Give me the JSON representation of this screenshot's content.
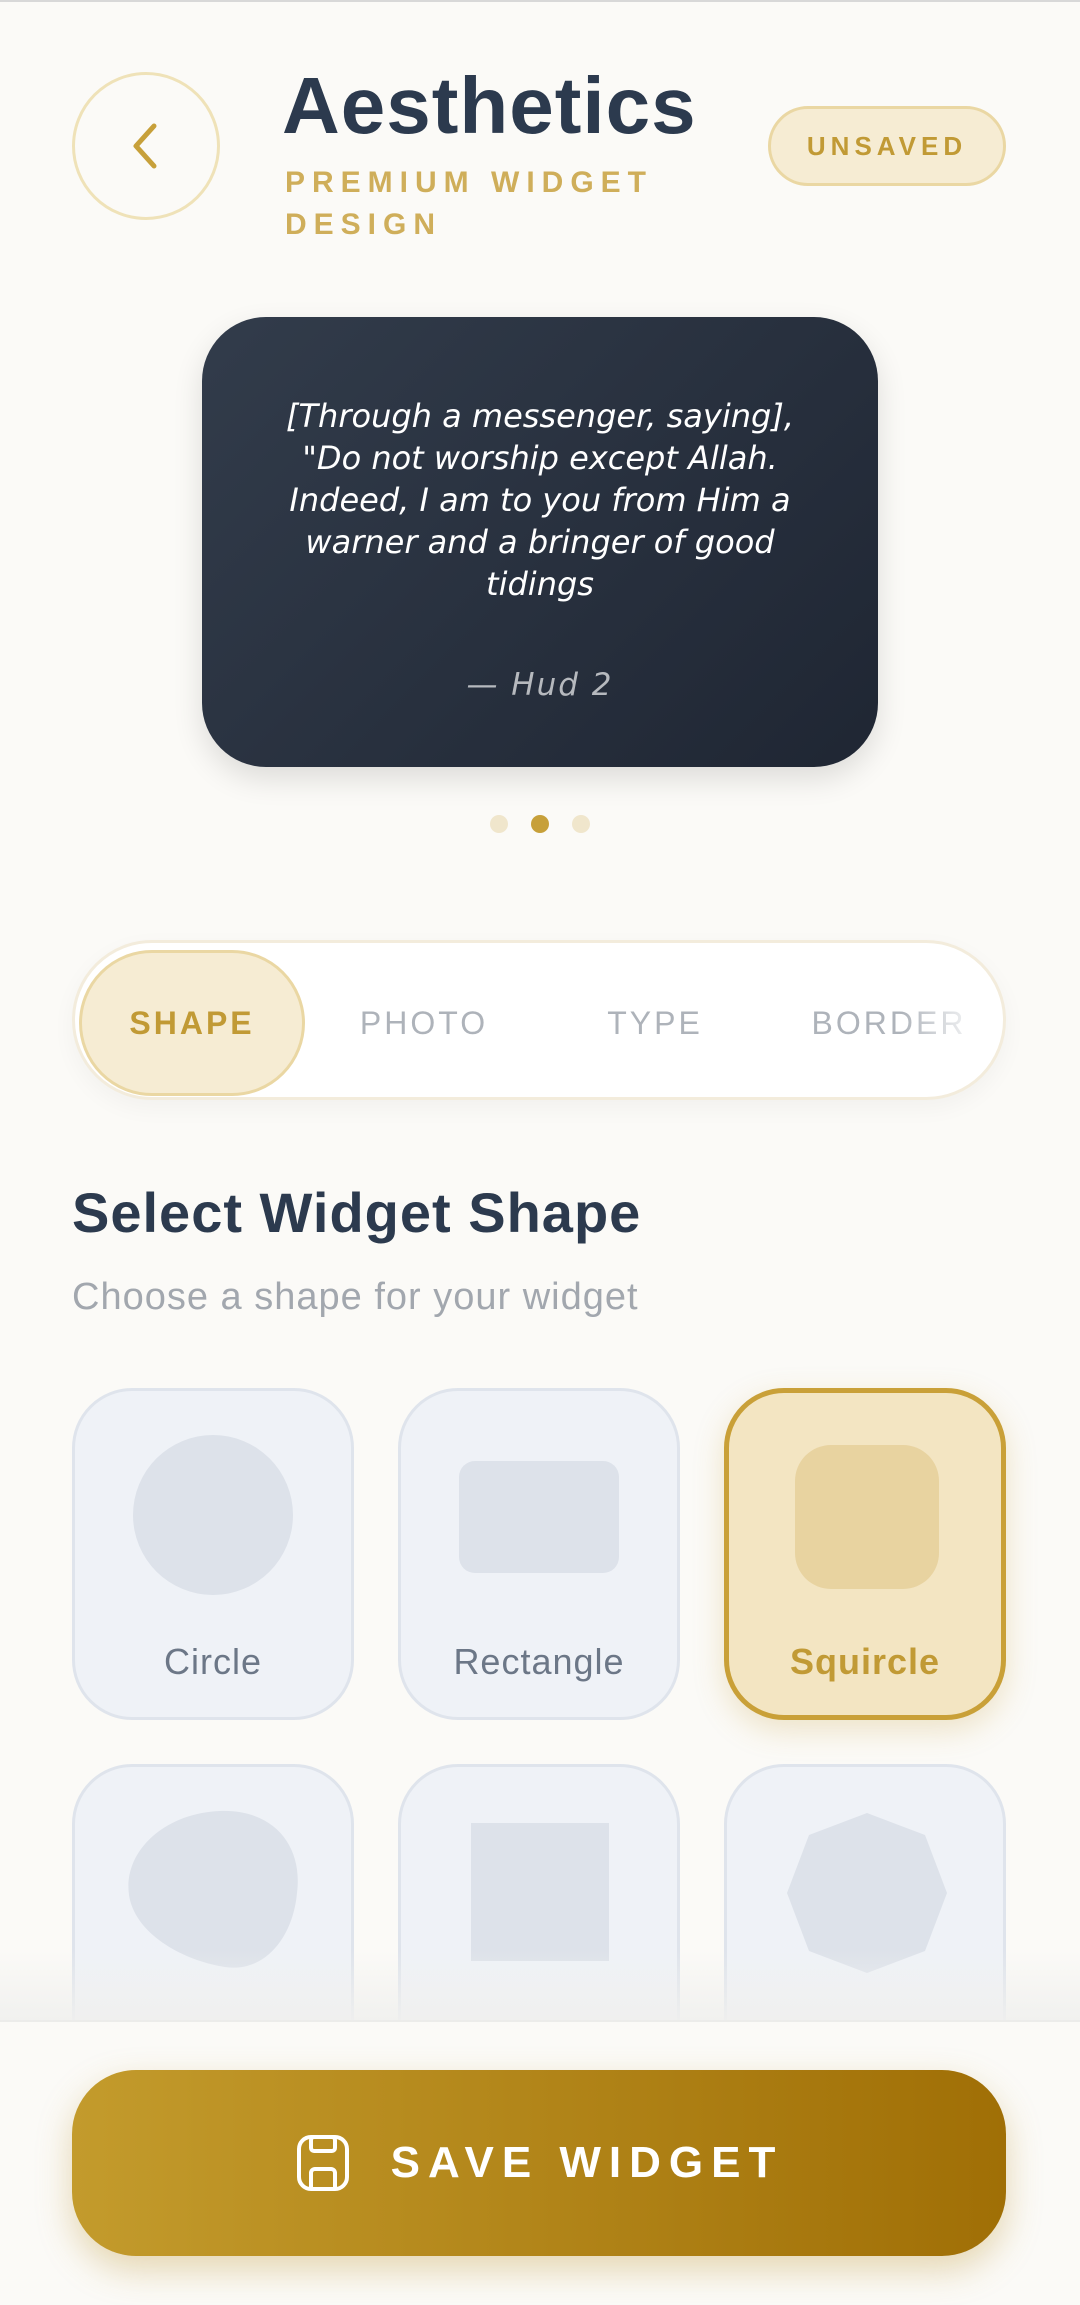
{
  "header": {
    "title": "Aesthetics",
    "subtitle": "PREMIUM WIDGET DESIGN",
    "status_badge": "UNSAVED"
  },
  "preview": {
    "quote": "[Through a messenger, saying], \"Do not worship except Allah. Indeed, I am to you from Him a warner and a bringer of good tidings",
    "reference": "— Hud 2",
    "pages": 3,
    "active_page": 2
  },
  "tabs": [
    {
      "label": "SHAPE",
      "active": true
    },
    {
      "label": "PHOTO",
      "active": false
    },
    {
      "label": "TYPE",
      "active": false
    },
    {
      "label": "BORDER",
      "active": false
    }
  ],
  "section": {
    "title": "Select Widget Shape",
    "subtitle": "Choose a shape for your widget"
  },
  "shapes": [
    {
      "label": "Circle",
      "selected": false
    },
    {
      "label": "Rectangle",
      "selected": false
    },
    {
      "label": "Squircle",
      "selected": true
    },
    {
      "label": "",
      "selected": false
    },
    {
      "label": "",
      "selected": false
    },
    {
      "label": "",
      "selected": false
    }
  ],
  "save_button": {
    "label": "SAVE WIDGET",
    "icon": "save-icon"
  },
  "colors": {
    "accent": "#c7a03a",
    "title": "#2c3a4e",
    "card": "#252d3a",
    "background": "#fbfaf7"
  }
}
